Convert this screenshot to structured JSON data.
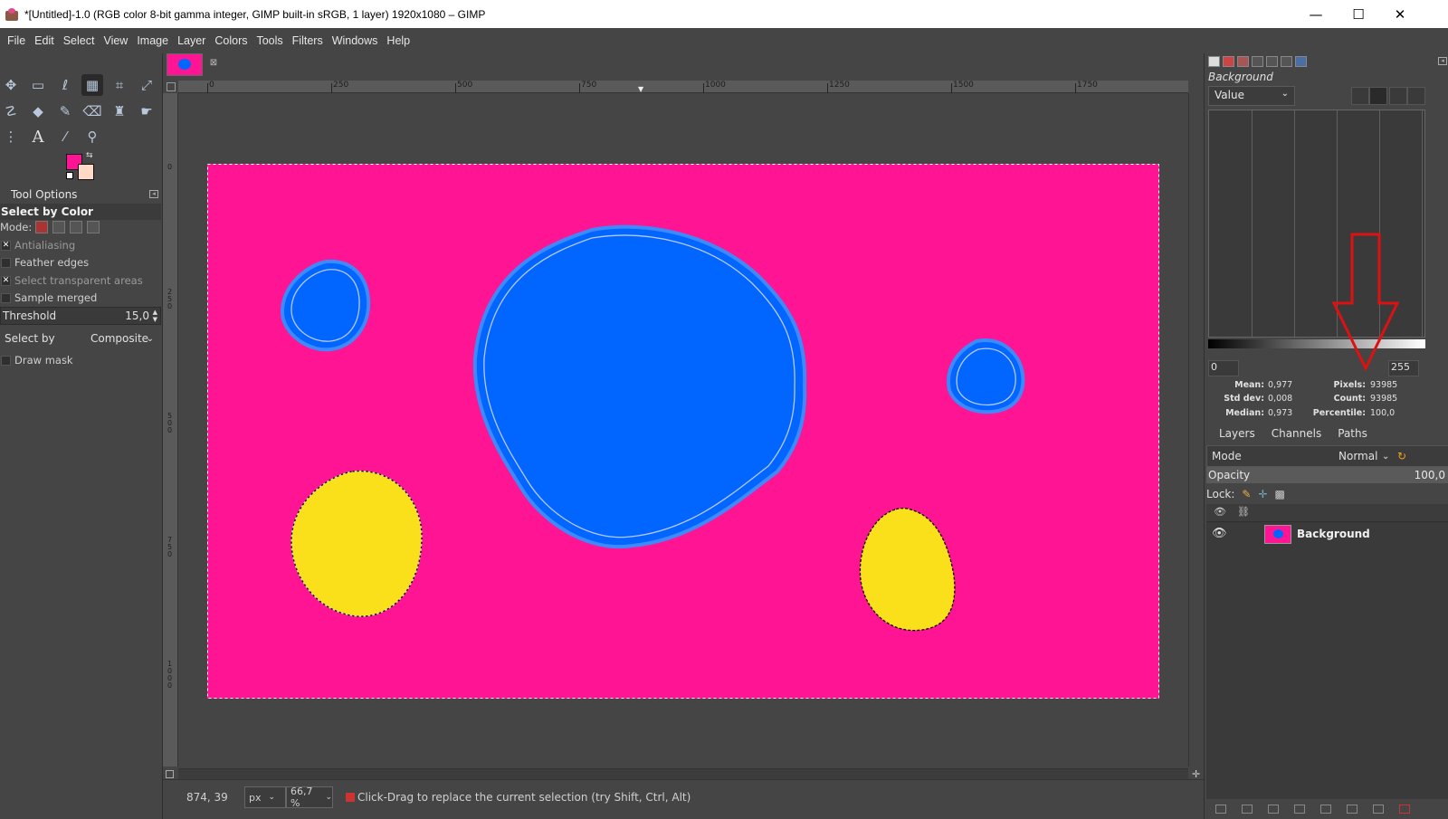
{
  "window": {
    "title": "*[Untitled]-1.0 (RGB color 8-bit gamma integer, GIMP built-in sRGB, 1 layer) 1920x1080 – GIMP",
    "minimize": "—",
    "maximize": "☐",
    "close": "✕"
  },
  "menu": [
    "File",
    "Edit",
    "Select",
    "View",
    "Image",
    "Layer",
    "Colors",
    "Tools",
    "Filters",
    "Windows",
    "Help"
  ],
  "toolbox": {
    "tools": [
      "move-tool",
      "rect-select-tool",
      "free-select-tool",
      "select-by-color-tool",
      "crop-tool",
      "transform-tool",
      "warp-tool",
      "bucket-fill-tool",
      "paintbrush-tool",
      "eraser-tool",
      "clone-tool",
      "smudge-tool",
      "path-tool",
      "text-tool",
      "color-picker-tool",
      "zoom-tool"
    ],
    "fg_color": "#ff1493",
    "bg_color": "#ffd8c8"
  },
  "tool_options": {
    "tab_label": "Tool Options",
    "title": "Select by Color",
    "mode_label": "Mode:",
    "antialiasing": "Antialiasing",
    "feather_edges": "Feather edges",
    "select_transparent": "Select transparent areas",
    "sample_merged": "Sample merged",
    "threshold_label": "Threshold",
    "threshold_value": "15,0",
    "select_by_label": "Select by",
    "select_by_value": "Composite",
    "draw_mask": "Draw mask"
  },
  "rulers": {
    "h_labels": [
      "0",
      "250",
      "500",
      "750",
      "1000",
      "1250",
      "1500",
      "1750"
    ],
    "v_labels": [
      "0",
      "250",
      "500",
      "750",
      "1000"
    ]
  },
  "canvas": {
    "background_color": "#ff1493",
    "blob_blue": "#0066ff",
    "blob_yellow": "#f9e01a"
  },
  "status": {
    "coords": "874, 39",
    "unit": "px",
    "zoom": "66,7 %",
    "message": "Click-Drag to replace the current selection (try Shift, Ctrl, Alt)"
  },
  "histogram": {
    "drawable": "Background",
    "channel": "Value",
    "range_min": "0",
    "range_max": "255",
    "stats": {
      "mean_label": "Mean:",
      "mean": "0,977",
      "stddev_label": "Std dev:",
      "stddev": "0,008",
      "median_label": "Median:",
      "median": "0,973",
      "pixels_label": "Pixels:",
      "pixels": "93985",
      "count_label": "Count:",
      "count": "93985",
      "percentile_label": "Percentile:",
      "percentile": "100,0"
    }
  },
  "layers": {
    "tabs": [
      "Layers",
      "Channels",
      "Paths"
    ],
    "mode_label": "Mode",
    "mode_value": "Normal",
    "opacity_label": "Opacity",
    "opacity_value": "100,0",
    "lock_label": "Lock:",
    "items": [
      {
        "name": "Background"
      }
    ]
  },
  "annotation": {
    "arrow_color": "#dd1111"
  }
}
